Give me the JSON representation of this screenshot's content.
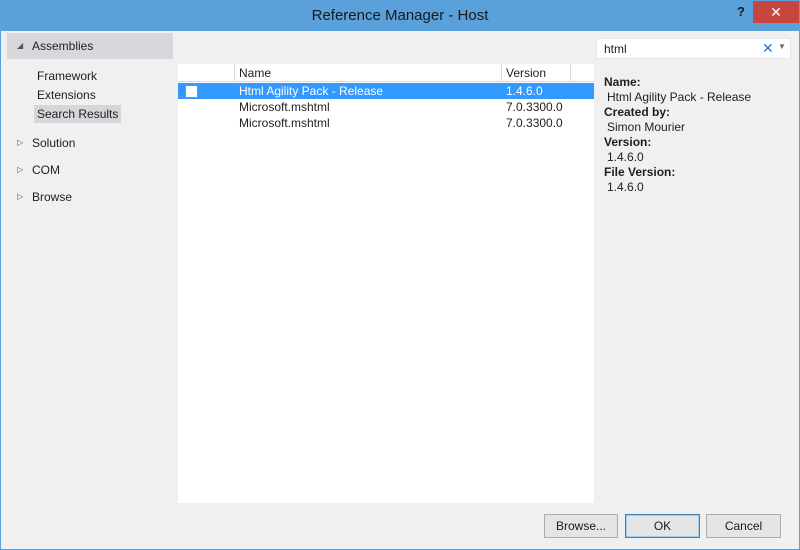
{
  "window": {
    "title": "Reference Manager - Host",
    "help_label": "?",
    "close_label": "✕"
  },
  "sidebar": {
    "assemblies": {
      "label": "Assemblies",
      "icon": "expanded-triangle-icon"
    },
    "sub_items": [
      "Framework",
      "Extensions",
      "Search Results"
    ],
    "groups": [
      {
        "label": "Solution",
        "icon": "collapsed-triangle-icon"
      },
      {
        "label": "COM",
        "icon": "collapsed-triangle-icon"
      },
      {
        "label": "Browse",
        "icon": "collapsed-triangle-icon"
      }
    ],
    "selected_sub_item": "Search Results"
  },
  "list": {
    "columns": [
      "Name",
      "Version"
    ],
    "rows": [
      {
        "name": "Html Agility Pack - Release",
        "version": "1.4.6.0",
        "checked": false,
        "selected": true
      },
      {
        "name": "Microsoft.mshtml",
        "version": "7.0.3300.0",
        "checked": false,
        "selected": false
      },
      {
        "name": "Microsoft.mshtml",
        "version": "7.0.3300.0",
        "checked": false,
        "selected": false
      }
    ]
  },
  "search": {
    "value": "html",
    "clear_icon": "clear-x-icon",
    "dropdown_icon": "dropdown-arrow-icon"
  },
  "details": {
    "name_label": "Name:",
    "name_value": "Html Agility Pack - Release",
    "created_label": "Created by:",
    "created_value": "Simon Mourier",
    "version_label": "Version:",
    "version_value": "1.4.6.0",
    "file_version_label": "File Version:",
    "file_version_value": "1.4.6.0"
  },
  "buttons": {
    "browse": "Browse...",
    "ok": "OK",
    "cancel": "Cancel"
  },
  "colors": {
    "title_bar": "#5aa0da",
    "close_button": "#c7463f",
    "selection": "#3399ff",
    "accent": "#2b76c2"
  }
}
